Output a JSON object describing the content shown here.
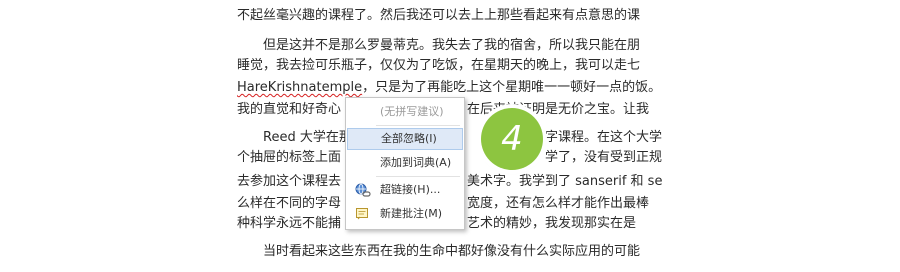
{
  "document": {
    "lines": [
      "不起丝毫兴趣的课程了。然后我还可以去上上那些看起来有点意思的课",
      "但是这并不是那么罗曼蒂克。我失去了我的宿舍，所以我只能在朋",
      "睡觉，我去捡可乐瓶子，仅仅为了吃饭，在星期天的晚上，我可以走七",
      "，只是为了再能吃上这个星期唯一一顿好一点的饭。",
      "我的直觉和好奇心",
      "在后来被证明是无价之宝。让我",
      "Reed 大学在那",
      "字课程。在这个大学",
      "个抽屉的标签上面",
      "学了，没有受到正规",
      "去参加这个课程去",
      "美术字。我学到了 sanserif 和 se",
      "么样在不同的字母",
      "宽度，还有怎么样才能作出最棒",
      "种科学永远不能捕",
      "艺术的精妙，我发现那实在是",
      "当时看起来这些东西在我的生命中都好像没有什么实际应用的可能"
    ],
    "misspelled_word": "HareKrishnatemple",
    "grammar_flag": "一顿"
  },
  "context_menu": {
    "items": [
      {
        "label": "(无拼写建议)",
        "enabled": false
      },
      {
        "label": "全部忽略(I)",
        "enabled": true
      },
      {
        "label": "添加到词典(A)",
        "enabled": true
      },
      {
        "label": "超链接(H)...",
        "enabled": true,
        "icon": "hyperlink-icon"
      },
      {
        "label": "新建批注(M)",
        "enabled": true,
        "icon": "new-comment-icon"
      }
    ]
  },
  "step_badge": {
    "number": "4",
    "color": "#8dc540"
  },
  "colors": {
    "spelling_underline": "#d62020",
    "menu_highlight": "#dfe9f7"
  }
}
